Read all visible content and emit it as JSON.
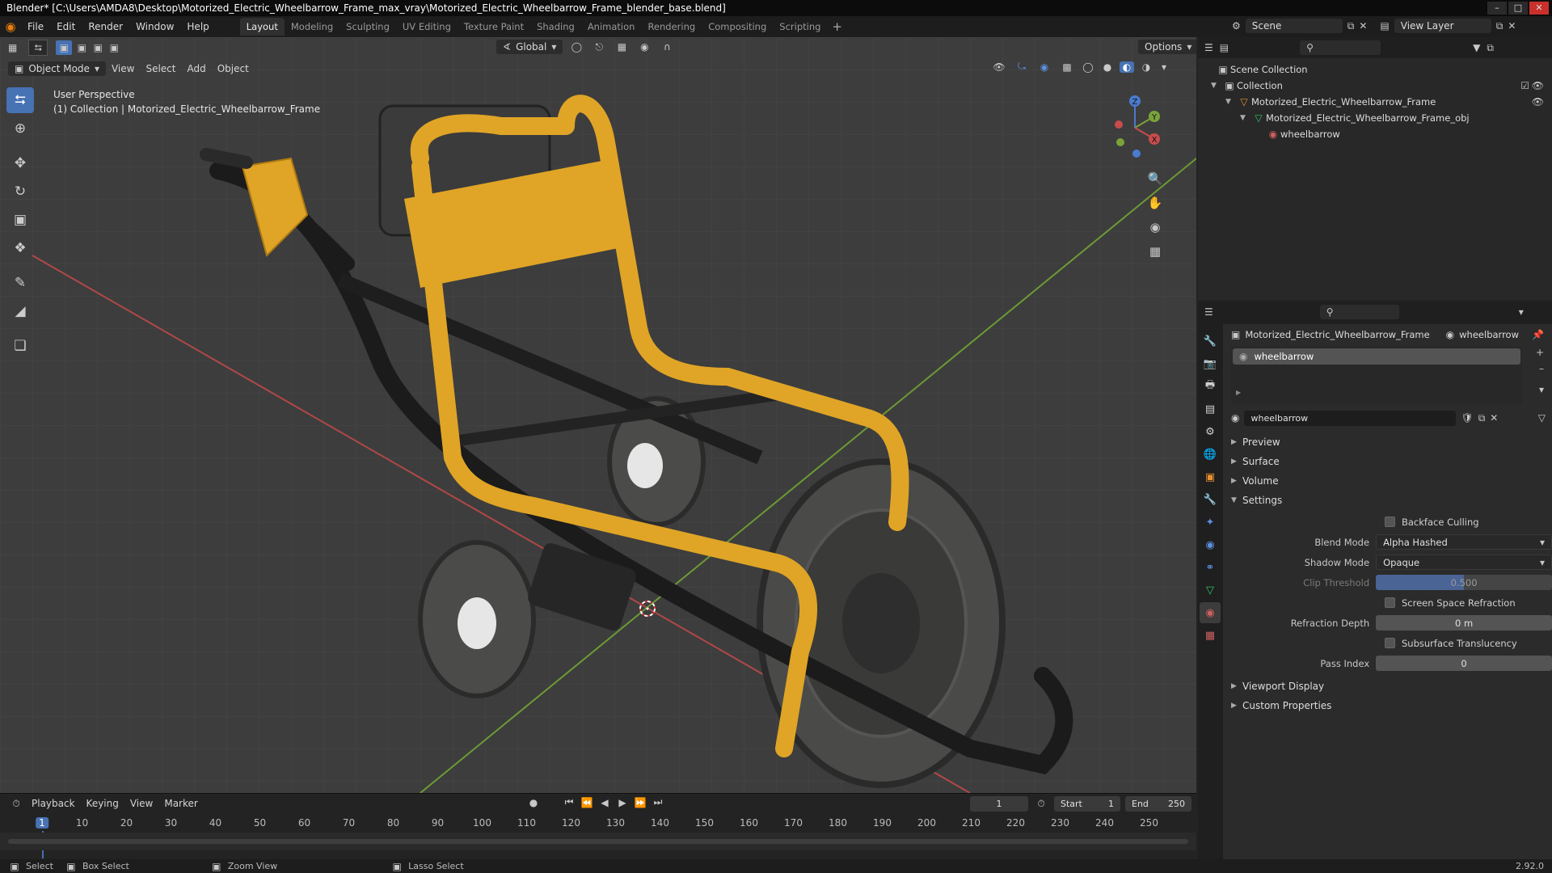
{
  "window": {
    "title": "Blender* [C:\\Users\\AMDA8\\Desktop\\Motorized_Electric_Wheelbarrow_Frame_max_vray\\Motorized_Electric_Wheelbarrow_Frame_blender_base.blend]"
  },
  "menu": [
    "File",
    "Edit",
    "Render",
    "Window",
    "Help"
  ],
  "workspaces": [
    "Layout",
    "Modeling",
    "Sculpting",
    "UV Editing",
    "Texture Paint",
    "Shading",
    "Animation",
    "Rendering",
    "Compositing",
    "Scripting"
  ],
  "active_workspace": "Layout",
  "scene": {
    "label": "Scene",
    "view_layer": "View Layer"
  },
  "viewport": {
    "transform_orientation": "Global",
    "options_label": "Options",
    "mode": "Object Mode",
    "header_menus": [
      "View",
      "Select",
      "Add",
      "Object"
    ],
    "overlay_line1": "User Perspective",
    "overlay_line2": "(1) Collection | Motorized_Electric_Wheelbarrow_Frame",
    "gizmo_axes": [
      "Z",
      "Y",
      "X"
    ]
  },
  "outliner": {
    "rows": [
      {
        "label": "Scene Collection"
      },
      {
        "label": "Collection"
      },
      {
        "label": "Motorized_Electric_Wheelbarrow_Frame"
      },
      {
        "label": "Motorized_Electric_Wheelbarrow_Frame_obj"
      },
      {
        "label": "wheelbarrow"
      }
    ]
  },
  "properties": {
    "breadcrumb_object": "Motorized_Electric_Wheelbarrow_Frame",
    "breadcrumb_material": "wheelbarrow",
    "material_slot": "wheelbarrow",
    "material_name": "wheelbarrow",
    "panels": {
      "preview": "Preview",
      "surface": "Surface",
      "volume": "Volume",
      "settings": "Settings",
      "viewport_display": "Viewport Display",
      "custom_properties": "Custom Properties"
    },
    "settings": {
      "backface_culling": "Backface Culling",
      "blend_mode_label": "Blend Mode",
      "blend_mode": "Alpha Hashed",
      "shadow_mode_label": "Shadow Mode",
      "shadow_mode": "Opaque",
      "clip_threshold_label": "Clip Threshold",
      "clip_threshold": "0.500",
      "screen_space_refraction": "Screen Space Refraction",
      "refraction_depth_label": "Refraction Depth",
      "refraction_depth": "0 m",
      "subsurface_translucency": "Subsurface Translucency",
      "pass_index_label": "Pass Index",
      "pass_index": "0"
    }
  },
  "timeline": {
    "menus": [
      "Playback",
      "Keying",
      "View",
      "Marker"
    ],
    "current_frame": "1",
    "start_label": "Start",
    "start": "1",
    "end_label": "End",
    "end": "250",
    "ruler": [
      "1",
      "10",
      "20",
      "30",
      "40",
      "50",
      "60",
      "70",
      "80",
      "90",
      "100",
      "110",
      "120",
      "130",
      "140",
      "150",
      "160",
      "170",
      "180",
      "190",
      "200",
      "210",
      "220",
      "230",
      "240",
      "250"
    ]
  },
  "statusbar": {
    "select": "Select",
    "box_select": "Box Select",
    "zoom_view": "Zoom View",
    "lasso_select": "Lasso Select",
    "version": "2.92.0"
  },
  "colors": {
    "accent_blue": "#4772b3",
    "frame_yellow": "#e0a526",
    "axis_red": "#c84c4c",
    "axis_green": "#7aa23a"
  }
}
